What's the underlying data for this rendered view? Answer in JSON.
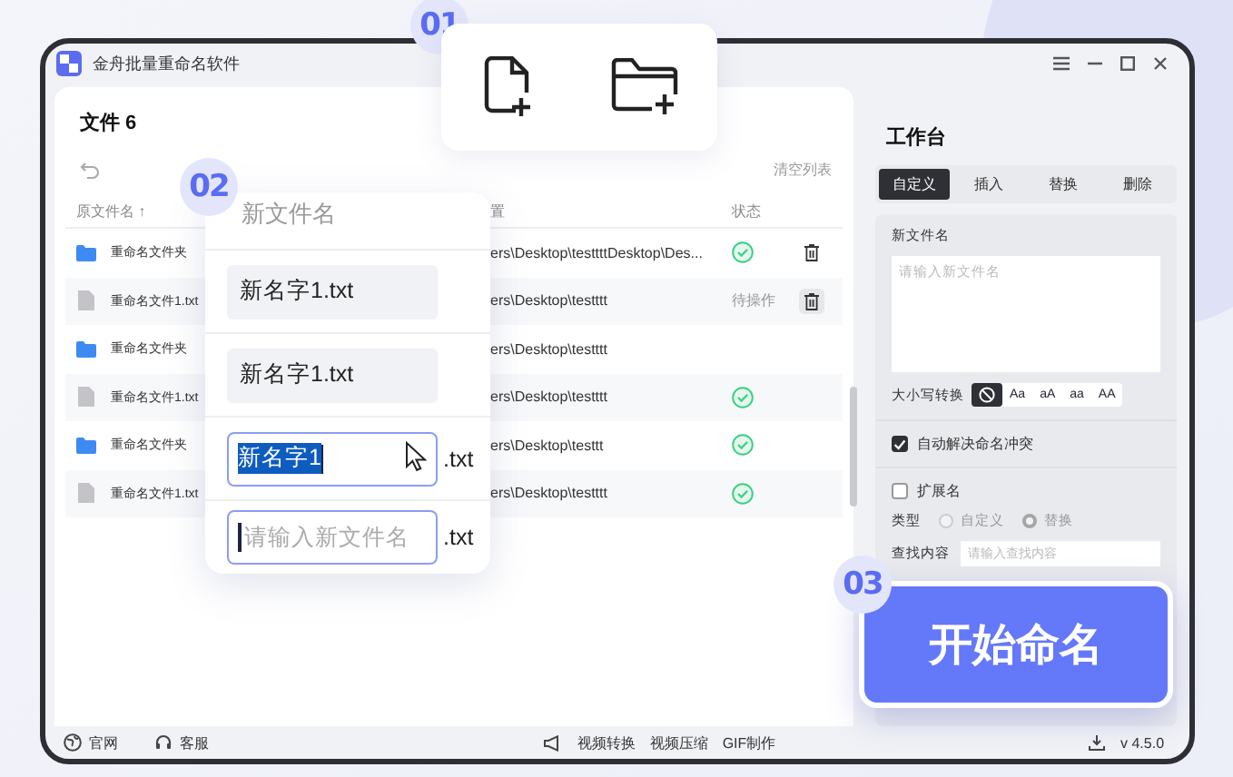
{
  "window": {
    "title": "金舟批量重命名软件"
  },
  "file_panel": {
    "title": "文件 6",
    "clear_label": "清空列表",
    "columns": [
      "原文件名 ↑",
      "置",
      "状态"
    ],
    "rows": [
      {
        "kind": "folder",
        "name": "重命名文件夹",
        "path": "ers\\Desktop\\testtttDesktop\\Des...",
        "status": {
          "kind": "done"
        },
        "delete_button": {
          "highlighted": false
        }
      },
      {
        "kind": "file",
        "name": "重命名文件1.txt",
        "path": "ers\\Desktop\\testttt",
        "status": {
          "kind": "pending",
          "label": "待操作"
        },
        "delete_button": {
          "highlighted": true
        }
      },
      {
        "kind": "folder",
        "name": "重命名文件夹",
        "path": "ers\\Desktop\\testttt"
      },
      {
        "kind": "file",
        "name": "重命名文件1.txt",
        "path": "ers\\Desktop\\testttt",
        "status": {
          "kind": "done"
        }
      },
      {
        "kind": "folder",
        "name": "重命名文件夹",
        "path": "ers\\Desktop\\testtt",
        "status": {
          "kind": "done"
        }
      },
      {
        "kind": "file",
        "name": "重命名文件1.txt",
        "path": "ers\\Desktop\\testttt",
        "status": {
          "kind": "done"
        }
      }
    ]
  },
  "workbench": {
    "title": "工作台",
    "tabs": [
      {
        "label": "自定义",
        "selected": true
      },
      {
        "label": "插入",
        "selected": false
      },
      {
        "label": "替换",
        "selected": false
      },
      {
        "label": "删除",
        "selected": false
      }
    ],
    "new_name": {
      "label": "新文件名",
      "placeholder": "请输入新文件名"
    },
    "case": {
      "label": "大小写转换",
      "options": [
        {
          "kind": "icon",
          "selected": true
        },
        {
          "kind": "text",
          "label": "Aa",
          "selected": false
        },
        {
          "kind": "text",
          "label": "aA",
          "selected": false
        },
        {
          "kind": "text",
          "label": "aa",
          "selected": false
        },
        {
          "kind": "text",
          "label": "AA",
          "selected": false
        }
      ]
    },
    "auto_resolve": {
      "label": "自动解决命名冲突",
      "checked": true
    },
    "extension": {
      "label": "扩展名",
      "checked": false
    },
    "type": {
      "label": "类型",
      "disabled": true,
      "options": [
        {
          "label": "自定义",
          "selected": false
        },
        {
          "label": "替换",
          "selected": true
        }
      ]
    },
    "find": {
      "label": "查找内容",
      "placeholder": "请输入查找内容"
    }
  },
  "footer": {
    "links": [
      {
        "kind": "globe",
        "label": "官网"
      },
      {
        "kind": "headset",
        "label": "客服"
      }
    ],
    "tools": [
      "视频转换",
      "视频压缩",
      "GIF制作"
    ],
    "version": "v 4.5.0"
  },
  "step_1": {
    "badge": "01"
  },
  "step_2": {
    "badge": "02",
    "title": "新文件名",
    "rows": [
      {
        "kind": "static",
        "value": "新名字1.txt"
      },
      {
        "kind": "static",
        "value": "新名字1.txt"
      },
      {
        "kind": "editing",
        "value": "新名字1",
        "suffix": ".txt"
      },
      {
        "kind": "empty",
        "placeholder": "请输入新文件名",
        "suffix": ".txt"
      }
    ]
  },
  "step_3": {
    "badge": "03",
    "button": "开始命名"
  }
}
